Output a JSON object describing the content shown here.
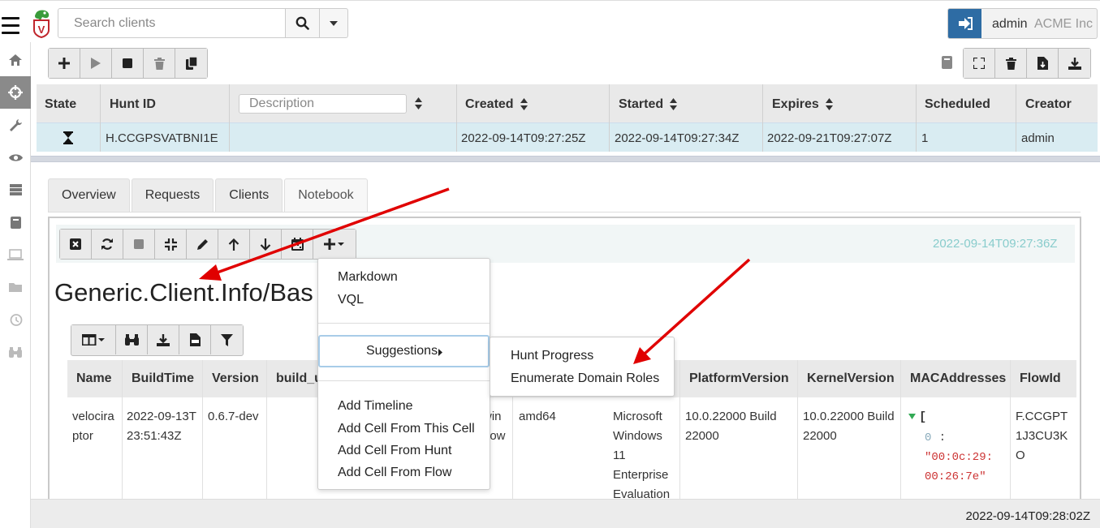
{
  "topbar": {
    "search_placeholder": "Search clients",
    "user": "admin",
    "org": "ACME Inc"
  },
  "sidebar": {
    "items": [
      "home-icon",
      "crosshairs-icon",
      "wrench-icon",
      "eye-icon",
      "server-icon",
      "book-icon",
      "laptop-icon",
      "folder-icon",
      "history-icon",
      "binoculars-icon"
    ],
    "active": "crosshairs-icon"
  },
  "hunts": {
    "columns": {
      "state": "State",
      "hunt_id": "Hunt ID",
      "description_placeholder": "Description",
      "created": "Created",
      "started": "Started",
      "expires": "Expires",
      "scheduled": "Scheduled",
      "creator": "Creator"
    },
    "rows": [
      {
        "state_icon": "hourglass-icon",
        "hunt_id": "H.CCGPSVATBNI1E",
        "description": "",
        "created": "2022-09-14T09:27:25Z",
        "started": "2022-09-14T09:27:34Z",
        "expires": "2022-09-21T09:27:07Z",
        "scheduled": "1",
        "creator": "admin"
      }
    ]
  },
  "tabs": [
    "Overview",
    "Requests",
    "Clients",
    "Notebook"
  ],
  "active_tab": "Notebook",
  "notebook": {
    "timestamp": "2022-09-14T09:27:36Z",
    "title": "Generic.Client.Info/Bas",
    "table": {
      "columns": [
        "Name",
        "BuildTime",
        "Version",
        "build_u",
        "PlatformVersion",
        "KernelVersion",
        "MACAddresses",
        "FlowId"
      ],
      "row": {
        "name": "velociraptor",
        "build_time": "2022-09-13T23:51:43Z",
        "version": "0.6.7-dev",
        "partial_os": "win dow",
        "arch": "amd64",
        "platform": "Microsoft Windows 11 Enterprise Evaluation",
        "platform_version": "10.0.22000 Build 22000",
        "kernel_version": "10.0.22000 Build 22000",
        "mac_index": "0",
        "mac_value": "\"00:0c:29:00:26:7e\"",
        "flow_id": "F.CCGPT1J3CU3KO"
      }
    }
  },
  "add_menu": {
    "items_top": [
      "Markdown",
      "VQL"
    ],
    "suggestions_label": "Suggestions",
    "items_bottom": [
      "Add Timeline",
      "Add Cell From This Cell",
      "Add Cell From Hunt",
      "Add Cell From Flow"
    ],
    "submenu": [
      "Hunt Progress",
      "Enumerate Domain Roles"
    ]
  },
  "status": {
    "time": "2022-09-14T09:28:02Z"
  },
  "colors": {
    "logout_button": "#2e6ca4",
    "selected_row": "#d9ecf2",
    "active_sidebar": "#8a8a8a",
    "annotation_arrow": "#e00000",
    "timestamp_text": "#88cccc"
  }
}
